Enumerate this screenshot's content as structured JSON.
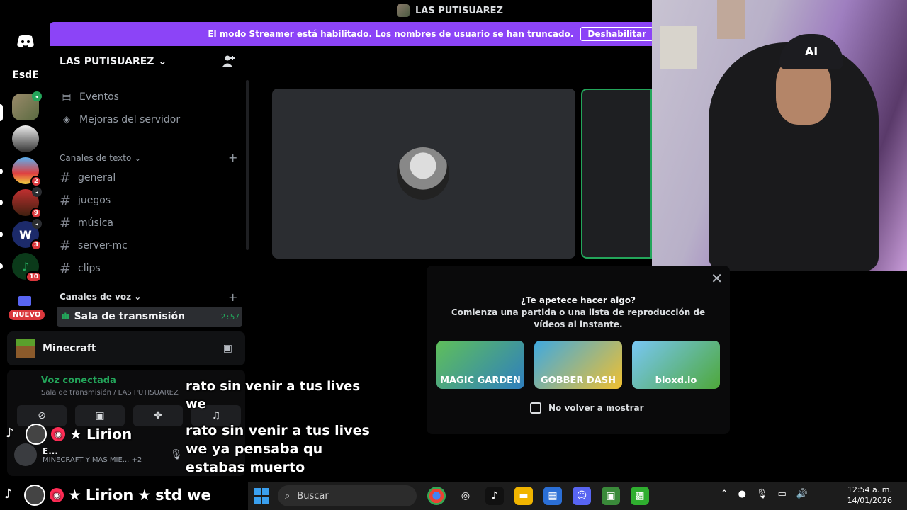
{
  "window": {
    "title": "LAS PUTISUAREZ"
  },
  "banner": {
    "message": "El modo Streamer está habilitado. Los nombres de usuario se han truncado.",
    "button": "Deshabilitar"
  },
  "rail": {
    "esde": "EsdE",
    "badges": [
      "2",
      "9",
      "3",
      "10"
    ],
    "nuevo": "NUEVO"
  },
  "server": {
    "name": "LAS PUTISUAREZ",
    "nav": [
      {
        "label": "Eventos",
        "icon": "calendar-icon"
      },
      {
        "label": "Mejoras del servidor",
        "icon": "boost-icon"
      }
    ],
    "text_category": "Canales de texto",
    "text_channels": [
      "general",
      "juegos",
      "música",
      "server-mc",
      "clips"
    ],
    "voice_category": "Canales de voz",
    "voice_channel": {
      "name": "Sala de transmisión",
      "time": "2:57"
    }
  },
  "activity": {
    "name": "Minecraft"
  },
  "voice_connection": {
    "title": "Voz conectada",
    "subtitle": "Sala de transmisión / LAS PUTISUAREZ",
    "user_name": "E...",
    "user_status": "MINECRAFT Y MAS MIE...",
    "extra": "+2"
  },
  "modal": {
    "title": "¿Te apetece hacer algo?",
    "subtitle": "Comienza una partida o una lista de reproducción de vídeos al instante.",
    "games": [
      "MAGIC GARDEN",
      "GOBBER DASH",
      "bloxd.io"
    ],
    "checkbox_label": "No volver a mostrar"
  },
  "overlay": {
    "line_top_1": "rato sin venir a tus lives",
    "line_top_2": "we",
    "user": "Lirion",
    "msg_lines": [
      "rato sin venir a tus lives",
      "we ya pensaba qu",
      "estabas muerto"
    ],
    "bottom_user": "Lirion",
    "bottom_msg": "std we"
  },
  "webcam": {
    "cap_text": "AI"
  },
  "taskbar": {
    "search_placeholder": "Buscar",
    "time": "12:54 a. m.",
    "date": "14/01/2026"
  },
  "colors": {
    "brand": "#8c44f7",
    "green": "#23a55a",
    "red": "#da373c"
  }
}
